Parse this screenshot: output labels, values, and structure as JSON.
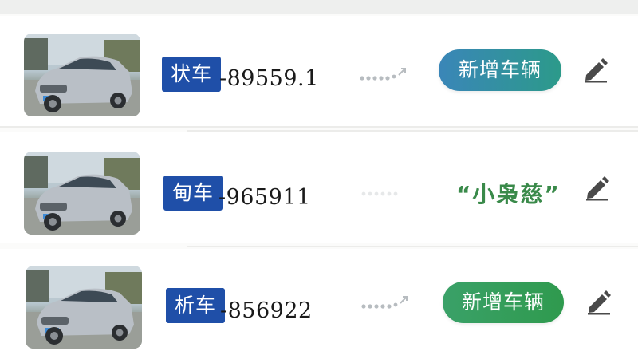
{
  "vehicles": [
    {
      "plate_prefix": "状车",
      "plate_number": "-89559.1",
      "action_type": "button",
      "action_label": "新增车辆",
      "icon": "pencil-icon"
    },
    {
      "plate_prefix": "甸车",
      "plate_number": "-965911",
      "action_type": "quote",
      "action_label": "“小枭慈”",
      "icon": "pencil-icon"
    },
    {
      "plate_prefix": "析车",
      "plate_number": "-856922",
      "action_type": "button",
      "action_label": "新增车辆",
      "icon": "pencil-icon"
    }
  ],
  "colors": {
    "plate_badge": "#1f4fa8",
    "button_blue": "#3a86b8",
    "button_green": "#2f9a4e",
    "quote_green": "#3a8a4a"
  }
}
